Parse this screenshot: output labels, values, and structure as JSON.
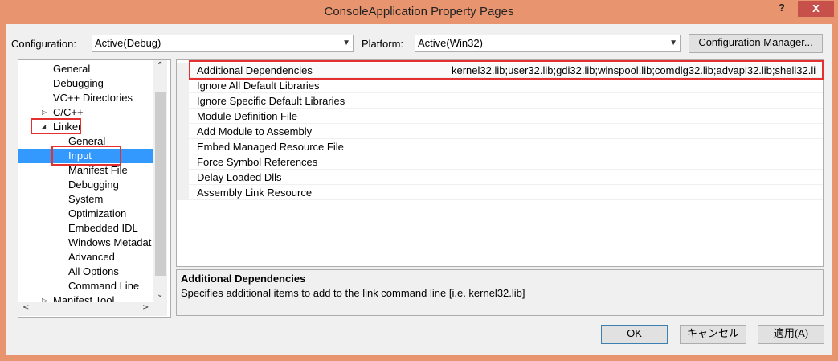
{
  "window": {
    "title": "ConsoleApplication Property Pages",
    "help_label": "?",
    "close_label": "X"
  },
  "toolbar": {
    "configuration_label": "Configuration:",
    "configuration_value": "Active(Debug)",
    "platform_label": "Platform:",
    "platform_value": "Active(Win32)",
    "configuration_manager_label": "Configuration Manager..."
  },
  "tree": {
    "items": [
      {
        "label": "General"
      },
      {
        "label": "Debugging"
      },
      {
        "label": "VC++ Directories"
      },
      {
        "label": "C/C++"
      },
      {
        "label": "Linker"
      },
      {
        "label": "General"
      },
      {
        "label": "Input"
      },
      {
        "label": "Manifest File"
      },
      {
        "label": "Debugging"
      },
      {
        "label": "System"
      },
      {
        "label": "Optimization"
      },
      {
        "label": "Embedded IDL"
      },
      {
        "label": "Windows Metadat"
      },
      {
        "label": "Advanced"
      },
      {
        "label": "All Options"
      },
      {
        "label": "Command Line"
      },
      {
        "label": "Manifest Tool"
      }
    ],
    "selected": "Input"
  },
  "grid": {
    "rows": [
      {
        "name": "Additional Dependencies",
        "value": "kernel32.lib;user32.lib;gdi32.lib;winspool.lib;comdlg32.lib;advapi32.lib;shell32.li"
      },
      {
        "name": "Ignore All Default Libraries",
        "value": ""
      },
      {
        "name": "Ignore Specific Default Libraries",
        "value": ""
      },
      {
        "name": "Module Definition File",
        "value": ""
      },
      {
        "name": "Add Module to Assembly",
        "value": ""
      },
      {
        "name": "Embed Managed Resource File",
        "value": ""
      },
      {
        "name": "Force Symbol References",
        "value": ""
      },
      {
        "name": "Delay Loaded Dlls",
        "value": ""
      },
      {
        "name": "Assembly Link Resource",
        "value": ""
      }
    ]
  },
  "description": {
    "title": "Additional Dependencies",
    "text": "Specifies additional items to add to the link command line [i.e. kernel32.lib]"
  },
  "buttons": {
    "ok": "OK",
    "cancel": "キャンセル",
    "apply": "適用(A)"
  },
  "colors": {
    "title_bar": "#e8956f",
    "close_button": "#c7504a",
    "selection": "#3399ff",
    "highlight_box": "#e53030"
  }
}
